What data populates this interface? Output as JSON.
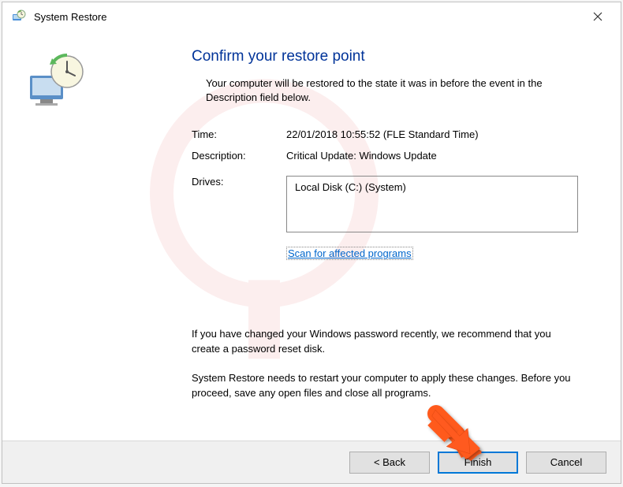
{
  "window": {
    "title": "System Restore"
  },
  "main": {
    "heading": "Confirm your restore point",
    "intro": "Your computer will be restored to the state it was in before the event in the Description field below.",
    "time_label": "Time:",
    "time_value": "22/01/2018 10:55:52 (FLE Standard Time)",
    "description_label": "Description:",
    "description_value": "Critical Update: Windows Update",
    "drives_label": "Drives:",
    "drives_value": "Local Disk (C:) (System)",
    "scan_link": "Scan for affected programs",
    "warning1": "If you have changed your Windows password recently, we recommend that you create a password reset disk.",
    "warning2": "System Restore needs to restart your computer to apply these changes. Before you proceed, save any open files and close all programs."
  },
  "buttons": {
    "back": "< Back",
    "finish": "Finish",
    "cancel": "Cancel"
  }
}
